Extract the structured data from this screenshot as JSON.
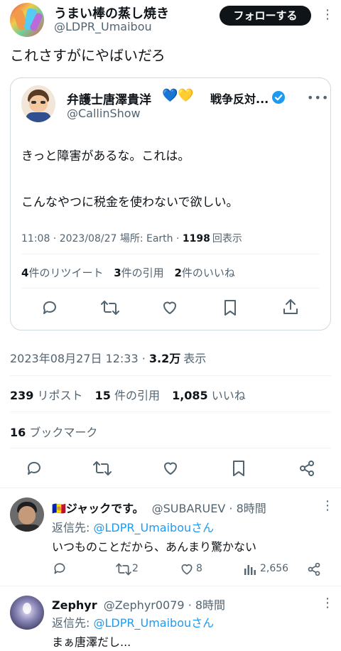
{
  "post": {
    "author_name": "うまい棒の蒸し焼き",
    "author_handle": "@LDPR_Umaibou",
    "follow_label": "フォローする",
    "text": "これさすがにやばいだろ",
    "timestamp": "2023年08月27日 12:33",
    "views_count": "3.2万",
    "views_label": "表示",
    "reposts_count": "239",
    "reposts_label": "リポスト",
    "quotes_count": "15",
    "quotes_label": "件の引用",
    "likes_count": "1,085",
    "likes_label": "いいね",
    "bookmarks_count": "16",
    "bookmarks_label": "ブックマーク"
  },
  "quoted": {
    "author_name": "弁護士唐澤貴洋",
    "hearts": "💙💛",
    "author_suffix": "戦争反対...",
    "author_handle": "@CallinShow",
    "line1": "きっと障害があるな。これは。",
    "line2": "こんなやつに税金を使わないで欲しい。",
    "meta_prefix": "11:08 · 2023/08/27 場所: Earth · ",
    "views_count": "1198",
    "views_label": "回表示",
    "retweets_count": "4",
    "retweets_label": "件のリツイート",
    "quotes_count": "3",
    "quotes_label": "件の引用",
    "likes_count": "2",
    "likes_label": "件のいいね"
  },
  "replies": [
    {
      "flag": "🇦🇩",
      "name": "ジャックです。",
      "handle": "@SUBARUEV",
      "time": "· 8時間",
      "reply_to_label": "返信先: ",
      "reply_to_handle": "@LDPR_Umaibouさん",
      "text": "いつものことだから、あんまり驚かない",
      "retweets": "2",
      "likes": "8",
      "views": "2,656"
    },
    {
      "name": "Zephyr",
      "handle": "@Zephyr0079",
      "time": "· 8時間",
      "reply_to_label": "返信先: ",
      "reply_to_handle": "@LDPR_Umaibouさん",
      "text": "まぁ唐澤だし..."
    }
  ],
  "colors": {
    "accent": "#1d9bf0",
    "text": "#0f1419",
    "muted": "#536471",
    "border": "#eff3f4",
    "follow_bg": "#0f1419"
  }
}
